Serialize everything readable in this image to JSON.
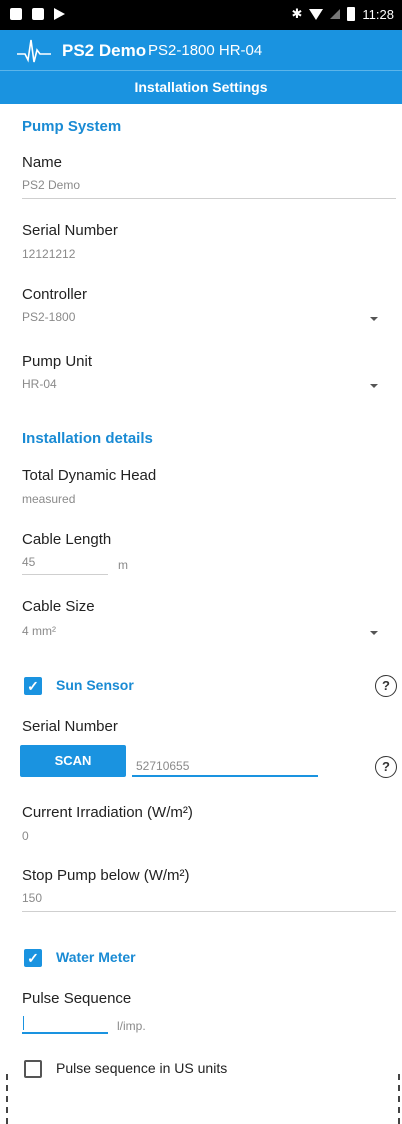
{
  "status_bar": {
    "time": "11:28",
    "icons": [
      "notification-icon",
      "notification-icon",
      "media-icon",
      "bluetooth-icon",
      "wifi-icon",
      "signal-icon",
      "battery-icon"
    ]
  },
  "app_bar": {
    "title": "PS2 Demo",
    "subtitle": "PS2-1800 HR-04",
    "logo": "waveform-logo-icon"
  },
  "sub_bar": {
    "title": "Installation Settings"
  },
  "pump_system": {
    "header": "Pump System",
    "name_label": "Name",
    "name_value": "PS2 Demo",
    "serial_label": "Serial Number",
    "serial_value": "12121212",
    "controller_label": "Controller",
    "controller_value": "PS2-1800",
    "pump_unit_label": "Pump Unit",
    "pump_unit_value": "HR-04"
  },
  "installation": {
    "header": "Installation details",
    "tdh_label": "Total Dynamic Head",
    "tdh_value": "measured",
    "cable_length_label": "Cable Length",
    "cable_length_value": "45",
    "cable_length_unit": "m",
    "cable_size_label": "Cable Size",
    "cable_size_value": "4 mm²"
  },
  "sun_sensor": {
    "checkbox_label": "Sun Sensor",
    "checked": true,
    "serial_label": "Serial Number",
    "scan_label": "SCAN",
    "serial_value": "52710655",
    "irradiation_label": "Current Irradiation (W/m²)",
    "irradiation_value": "0",
    "stop_label": "Stop Pump below (W/m²)",
    "stop_value": "150"
  },
  "water_meter": {
    "checkbox_label": "Water Meter",
    "checked": true,
    "pulse_label": "Pulse Sequence",
    "pulse_value": "",
    "pulse_unit": "l/imp.",
    "us_units_label": "Pulse sequence in US units",
    "us_units_checked": false
  },
  "colors": {
    "accent": "#1a93e0",
    "status_bar": "#000000",
    "section_header": "#1a8bd4"
  }
}
